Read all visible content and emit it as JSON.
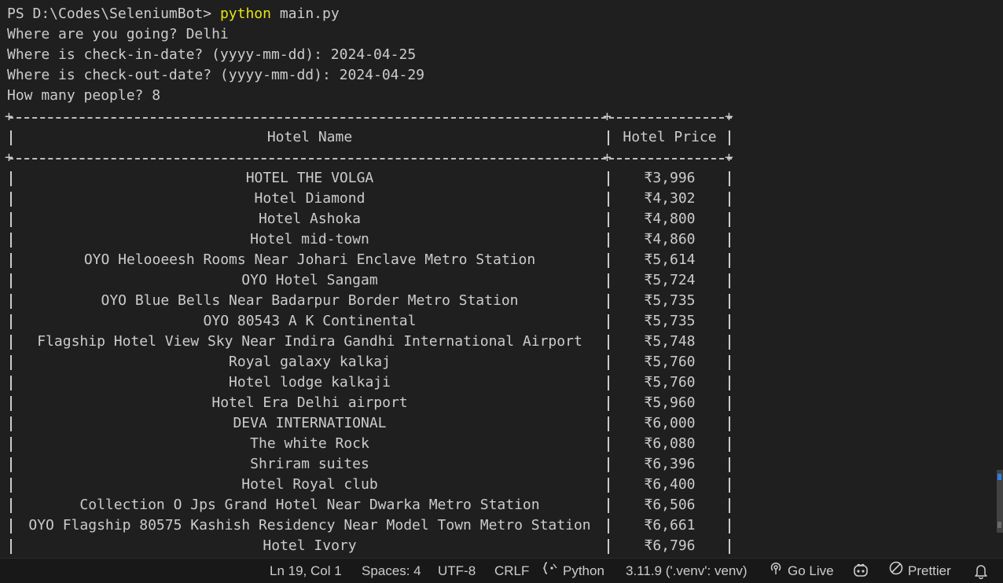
{
  "terminal": {
    "prompt_path": "PS D:\\Codes\\SeleniumBot>",
    "command": "python",
    "command_args": "main.py",
    "q1": "Where are you going? Delhi",
    "q2": "Where is check-in-date? (yyyy-mm-dd): 2024-04-25",
    "q3": "Where is check-out-date? (yyyy-mm-dd): 2024-04-29",
    "q4": "How many people? 8"
  },
  "table": {
    "headers": [
      "Hotel Name",
      "Hotel Price"
    ],
    "rows": [
      [
        "HOTEL THE VOLGA",
        "₹3,996"
      ],
      [
        "Hotel Diamond",
        "₹4,302"
      ],
      [
        "Hotel Ashoka",
        "₹4,800"
      ],
      [
        "Hotel mid-town",
        "₹4,860"
      ],
      [
        "OYO Helooeesh Rooms Near Johari Enclave Metro Station",
        "₹5,614"
      ],
      [
        "OYO Hotel Sangam",
        "₹5,724"
      ],
      [
        "OYO Blue Bells Near Badarpur Border Metro Station",
        "₹5,735"
      ],
      [
        "OYO 80543 A K Continental",
        "₹5,735"
      ],
      [
        "Flagship Hotel View Sky Near Indira Gandhi International Airport",
        "₹5,748"
      ],
      [
        "Royal galaxy kalkaj",
        "₹5,760"
      ],
      [
        "Hotel lodge kalkaji",
        "₹5,760"
      ],
      [
        "Hotel Era Delhi airport",
        "₹5,960"
      ],
      [
        "DEVA INTERNATIONAL",
        "₹6,000"
      ],
      [
        "The white Rock",
        "₹6,080"
      ],
      [
        "Shriram suites",
        "₹6,396"
      ],
      [
        "Hotel Royal club",
        "₹6,400"
      ],
      [
        "Collection O Jps Grand Hotel Near Dwarka Metro Station",
        "₹6,506"
      ],
      [
        "OYO Flagship 80575 Kashish Residency Near Model Town Metro Station",
        "₹6,661"
      ],
      [
        "Hotel Ivory",
        "₹6,796"
      ]
    ]
  },
  "statusbar": {
    "position": "Ln 19, Col 1",
    "spaces": "Spaces: 4",
    "encoding": "UTF-8",
    "eol": "CRLF",
    "language": "Python",
    "interpreter": "3.11.9 ('.venv': venv)",
    "go_live": "Go Live",
    "prettier": "Prettier"
  },
  "colors": {
    "background": "#1f1f1f",
    "text": "#cccccc",
    "command": "#e5e510",
    "statusbar_bg": "#181818",
    "scroll_mark": "#2f7de1"
  },
  "icons": {
    "language": "braces-icon",
    "go_live": "broadcast-icon",
    "copilot": "copilot-icon",
    "prettier": "prohibited-icon",
    "notifications": "bell-icon"
  }
}
